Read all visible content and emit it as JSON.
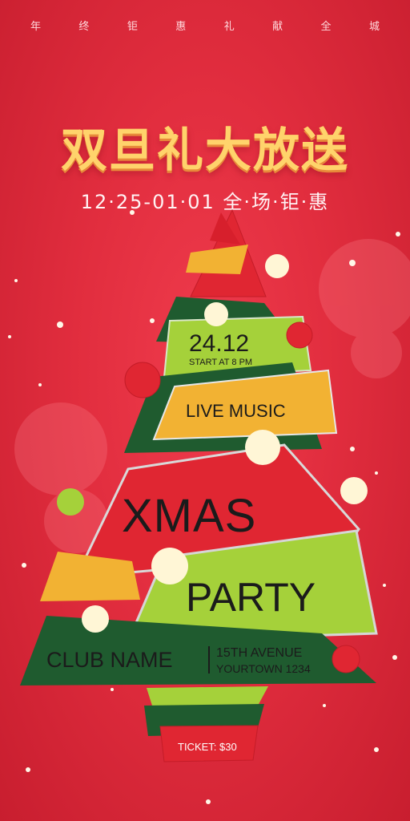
{
  "top_strip": [
    "年",
    "终",
    "钜",
    "惠",
    "礼",
    "献",
    "全",
    "城"
  ],
  "main_title": "双旦礼大放送",
  "date_line": "12·25-01·01 全·场·钜·惠",
  "event": {
    "date": "24.12",
    "start": "START AT 8 PM",
    "live": "LIVE MUSIC",
    "xmas": "XMAS",
    "party": "PARTY",
    "club": "CLUB NAME",
    "address_1": "15TH AVENUE",
    "address_2": "YOURTOWN 1234",
    "ticket": "TICKET: $30"
  },
  "colors": {
    "background": "#e12d3e",
    "title": "#ffd36b",
    "tree_green_dark": "#1f5b2f",
    "tree_green_light": "#a5d13a",
    "tree_yellow": "#f2b233",
    "tree_red": "#e02632"
  }
}
